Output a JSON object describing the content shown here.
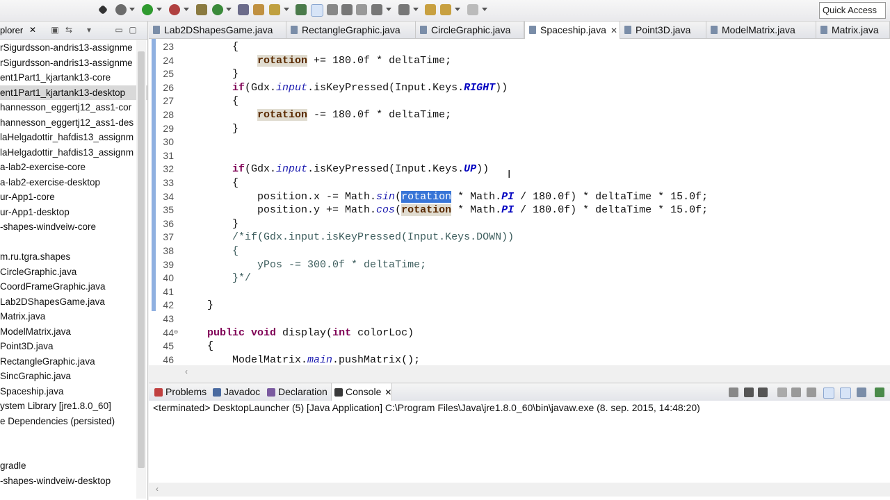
{
  "toolbar": {
    "quick_access": "Quick Access",
    "icons": [
      "skip-all-breakpoints-icon",
      "debug-icon",
      "run-icon",
      "coverage-icon",
      "new-package-icon",
      "new-class-icon",
      "open-type-icon",
      "search-icon",
      "next-annotation-icon",
      "prev-annotation-icon",
      "toggle-mark-occurrences-icon",
      "show-whitespace-icon",
      "back-icon",
      "forward-icon"
    ]
  },
  "explorer": {
    "title": "plorer",
    "items": [
      {
        "label": "rSigurdsson-andris13-assignme",
        "selected": false
      },
      {
        "label": "rSigurdsson-andris13-assignme",
        "selected": false
      },
      {
        "label": "ent1Part1_kjartank13-core",
        "selected": false
      },
      {
        "label": "ent1Part1_kjartank13-desktop",
        "selected": true
      },
      {
        "label": "hannesson_eggertj12_ass1-cor",
        "selected": false
      },
      {
        "label": "hannesson_eggertj12_ass1-des",
        "selected": false
      },
      {
        "label": "laHelgadottir_hafdis13_assignm",
        "selected": false
      },
      {
        "label": "laHelgadottir_hafdis13_assignm",
        "selected": false
      },
      {
        "label": "a-lab2-exercise-core",
        "selected": false
      },
      {
        "label": "a-lab2-exercise-desktop",
        "selected": false
      },
      {
        "label": "ur-App1-core",
        "selected": false
      },
      {
        "label": "ur-App1-desktop",
        "selected": false
      },
      {
        "label": "-shapes-windveiw-core",
        "selected": false
      },
      {
        "label": "",
        "selected": false
      },
      {
        "label": "m.ru.tgra.shapes",
        "selected": false
      },
      {
        "label": "CircleGraphic.java",
        "selected": false
      },
      {
        "label": "CoordFrameGraphic.java",
        "selected": false
      },
      {
        "label": "Lab2DShapesGame.java",
        "selected": false
      },
      {
        "label": "Matrix.java",
        "selected": false
      },
      {
        "label": "ModelMatrix.java",
        "selected": false
      },
      {
        "label": "Point3D.java",
        "selected": false
      },
      {
        "label": "RectangleGraphic.java",
        "selected": false
      },
      {
        "label": "SincGraphic.java",
        "selected": false
      },
      {
        "label": "Spaceship.java",
        "selected": false
      },
      {
        "label": "ystem Library [jre1.8.0_60]",
        "selected": false
      },
      {
        "label": "e Dependencies (persisted)",
        "selected": false
      },
      {
        "label": "",
        "selected": false
      },
      {
        "label": "",
        "selected": false
      },
      {
        "label": "gradle",
        "selected": false
      },
      {
        "label": "-shapes-windveiw-desktop",
        "selected": false
      }
    ]
  },
  "tabs": [
    {
      "label": "Lab2DShapesGame.java",
      "active": false
    },
    {
      "label": "RectangleGraphic.java",
      "active": false
    },
    {
      "label": "CircleGraphic.java",
      "active": false
    },
    {
      "label": "Spaceship.java",
      "active": true,
      "close": "✕"
    },
    {
      "label": "Point3D.java",
      "active": false
    },
    {
      "label": "ModelMatrix.java",
      "active": false
    },
    {
      "label": "Matrix.java",
      "active": false
    }
  ],
  "editor": {
    "lines": [
      {
        "n": "23",
        "tokens": [
          [
            "",
            "        {"
          ]
        ]
      },
      {
        "n": "24",
        "tokens": [
          [
            "",
            "            "
          ],
          [
            "var",
            "rotation"
          ],
          [
            "",
            " += 180.0f * deltaTime;"
          ]
        ]
      },
      {
        "n": "25",
        "tokens": [
          [
            "",
            "        }"
          ]
        ]
      },
      {
        "n": "26",
        "tokens": [
          [
            "",
            "        "
          ],
          [
            "kw",
            "if"
          ],
          [
            "",
            "(Gdx."
          ],
          [
            "fld",
            "input"
          ],
          [
            "",
            ".isKeyPressed(Input.Keys."
          ],
          [
            "sfld",
            "RIGHT"
          ],
          [
            "",
            "))"
          ]
        ]
      },
      {
        "n": "27",
        "tokens": [
          [
            "",
            "        {"
          ]
        ]
      },
      {
        "n": "28",
        "tokens": [
          [
            "",
            "            "
          ],
          [
            "var",
            "rotation"
          ],
          [
            "",
            " -= 180.0f * deltaTime;"
          ]
        ]
      },
      {
        "n": "29",
        "tokens": [
          [
            "",
            "        }"
          ]
        ]
      },
      {
        "n": "30",
        "tokens": [
          [
            "",
            ""
          ]
        ]
      },
      {
        "n": "31",
        "tokens": [
          [
            "",
            ""
          ]
        ]
      },
      {
        "n": "32",
        "tokens": [
          [
            "",
            "        "
          ],
          [
            "kw",
            "if"
          ],
          [
            "",
            "(Gdx."
          ],
          [
            "fld",
            "input"
          ],
          [
            "",
            ".isKeyPressed(Input.Keys."
          ],
          [
            "sfld",
            "UP"
          ],
          [
            "",
            "))"
          ]
        ]
      },
      {
        "n": "33",
        "tokens": [
          [
            "",
            "        {"
          ]
        ]
      },
      {
        "n": "34",
        "tokens": [
          [
            "",
            "            position.x -= Math."
          ],
          [
            "fld",
            "sin"
          ],
          [
            "",
            "("
          ],
          [
            "selword",
            "rotation"
          ],
          [
            "",
            " * Math."
          ],
          [
            "sfld",
            "PI"
          ],
          [
            "",
            " / 180.0f) * deltaTime * 15.0f;"
          ]
        ]
      },
      {
        "n": "35",
        "tokens": [
          [
            "",
            "            position.y += Math."
          ],
          [
            "fld",
            "cos"
          ],
          [
            "",
            "("
          ],
          [
            "var",
            "rotation"
          ],
          [
            "",
            " * Math."
          ],
          [
            "sfld",
            "PI"
          ],
          [
            "",
            " / 180.0f) * deltaTime * 15.0f;"
          ]
        ]
      },
      {
        "n": "36",
        "tokens": [
          [
            "",
            "        }"
          ]
        ]
      },
      {
        "n": "37",
        "tokens": [
          [
            "",
            "        "
          ],
          [
            "cmt",
            "/*if(Gdx.input.isKeyPressed(Input.Keys.DOWN))"
          ]
        ]
      },
      {
        "n": "38",
        "tokens": [
          [
            "",
            "        "
          ],
          [
            "cmt",
            "{"
          ]
        ]
      },
      {
        "n": "39",
        "tokens": [
          [
            "",
            "            "
          ],
          [
            "cmt",
            "yPos -= 300.0f * deltaTime;"
          ]
        ]
      },
      {
        "n": "40",
        "tokens": [
          [
            "",
            "        "
          ],
          [
            "cmt",
            "}*/"
          ]
        ]
      },
      {
        "n": "41",
        "tokens": [
          [
            "",
            ""
          ]
        ]
      },
      {
        "n": "42",
        "tokens": [
          [
            "",
            "    }"
          ]
        ]
      },
      {
        "n": "43",
        "tokens": [
          [
            "",
            ""
          ]
        ]
      },
      {
        "n": "44",
        "tokens": [
          [
            "",
            "    "
          ],
          [
            "kw",
            "public void"
          ],
          [
            "",
            " display("
          ],
          [
            "kw",
            "int"
          ],
          [
            "",
            " colorLoc)"
          ]
        ]
      },
      {
        "n": "45",
        "tokens": [
          [
            "",
            "    {"
          ]
        ]
      },
      {
        "n": "46",
        "tokens": [
          [
            "",
            "        ModelMatrix."
          ],
          [
            "fld",
            "main"
          ],
          [
            "",
            ".pushMatrix();"
          ]
        ]
      }
    ]
  },
  "console": {
    "tabs": [
      {
        "label": "Problems",
        "active": false
      },
      {
        "label": "Javadoc",
        "active": false
      },
      {
        "label": "Declaration",
        "active": false
      },
      {
        "label": "Console",
        "active": true,
        "close": "✕"
      }
    ],
    "status": "<terminated> DesktopLauncher (5) [Java Application] C:\\Program Files\\Java\\jre1.8.0_60\\bin\\javaw.exe (8. sep. 2015, 14:48:20)"
  },
  "colors": {
    "keyword": "#7f0055",
    "static_field": "#0000c0",
    "selection": "#3875d7",
    "occurrence": "#e0dcd0"
  }
}
